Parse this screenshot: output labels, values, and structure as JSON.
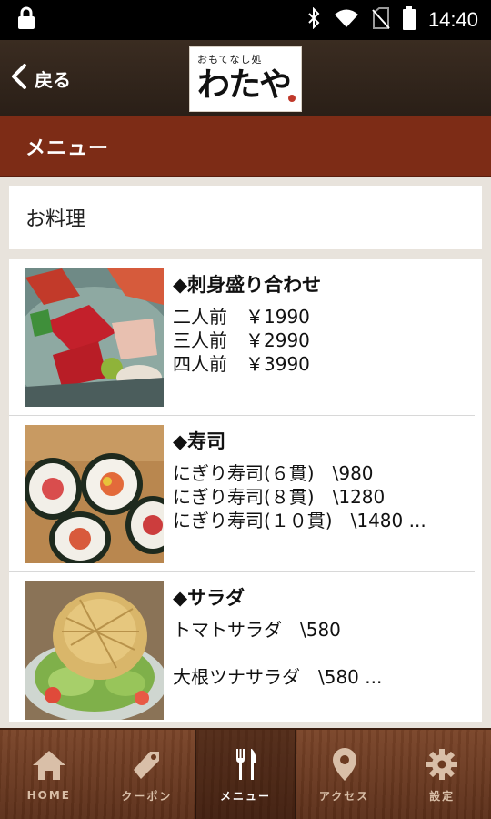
{
  "status_bar": {
    "time": "14:40"
  },
  "header": {
    "back_label": "戻る",
    "logo_subtitle": "おもてなし処",
    "logo_main": "わたや"
  },
  "section": {
    "title": "メニュー"
  },
  "category": {
    "title": "お料理"
  },
  "menu_items": [
    {
      "name": "◆刺身盛り合わせ",
      "lines": [
        "二人前　￥1990",
        "三人前　￥2990",
        "四人前　￥3990"
      ]
    },
    {
      "name": "◆寿司",
      "lines": [
        "にぎり寿司(６貫)　\\980",
        "にぎり寿司(８貫)　\\1280",
        "にぎり寿司(１０貫)　\\1480 ..."
      ]
    },
    {
      "name": "◆サラダ",
      "lines": [
        "トマトサラダ　\\580",
        "",
        "大根ツナサラダ　\\580 ..."
      ]
    }
  ],
  "bottom_nav": [
    {
      "label": "HOME",
      "icon": "home-icon"
    },
    {
      "label": "クーポン",
      "icon": "coupon-icon"
    },
    {
      "label": "メニュー",
      "icon": "fork-knife-icon",
      "active": true
    },
    {
      "label": "アクセス",
      "icon": "location-pin-icon"
    },
    {
      "label": "設定",
      "icon": "gear-icon"
    }
  ],
  "colors": {
    "header_bg": "#2f231a",
    "section_bar": "#7d2c16",
    "nav_wood": "#6b3a20"
  }
}
